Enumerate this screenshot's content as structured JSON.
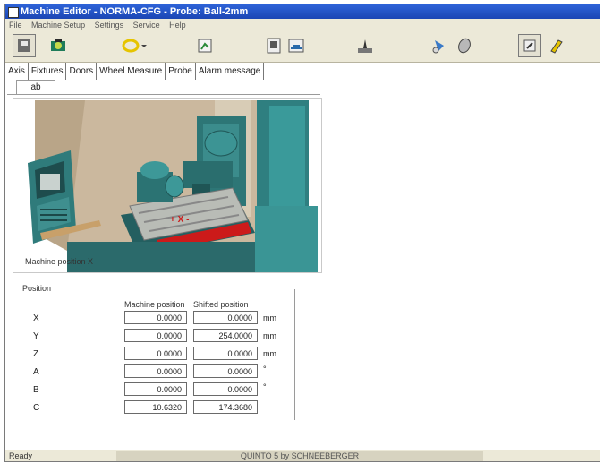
{
  "window": {
    "title": "Machine Editor - NORMA-CFG - Probe: Ball-2mm"
  },
  "menu": [
    "File",
    "Machine Setup",
    "Settings",
    "Service",
    "Help"
  ],
  "toolbar": {
    "buttons": [
      "save-icon",
      "machine-icon",
      "probe-icon",
      "measure-icon",
      "report-icon",
      "chart-icon",
      "calibrate-icon",
      "probe-tool-icon",
      "wheel-icon",
      "settings-icon",
      "wizard-icon"
    ]
  },
  "tabs": [
    "Axis",
    "Fixtures",
    "Doors",
    "Wheel Measure",
    "Probe",
    "Alarm message"
  ],
  "subtab": "ab",
  "picture": {
    "caption": "Machine position X"
  },
  "positions": {
    "section_title": "Position",
    "col_machine": "Machine position",
    "col_shifted": "Shifted position",
    "rows": [
      {
        "axis": "X",
        "machine": "0.0000",
        "shifted": "0.0000",
        "unit": "mm"
      },
      {
        "axis": "Y",
        "machine": "0.0000",
        "shifted": "254.0000",
        "unit": "mm"
      },
      {
        "axis": "Z",
        "machine": "0.0000",
        "shifted": "0.0000",
        "unit": "mm"
      },
      {
        "axis": "A",
        "machine": "0.0000",
        "shifted": "0.0000",
        "unit": "°"
      },
      {
        "axis": "B",
        "machine": "0.0000",
        "shifted": "0.0000",
        "unit": "°"
      },
      {
        "axis": "C",
        "machine": "10.6320",
        "shifted": "174.3680",
        "unit": ""
      }
    ]
  },
  "status": {
    "left": "Ready",
    "center": "QUINTO 5 by SCHNEEBERGER"
  },
  "colors": {
    "titlebar": "#1b46b4",
    "chrome": "#ece9d8",
    "machine_teal": "#2f7a7a",
    "accent_red": "#d01818"
  }
}
